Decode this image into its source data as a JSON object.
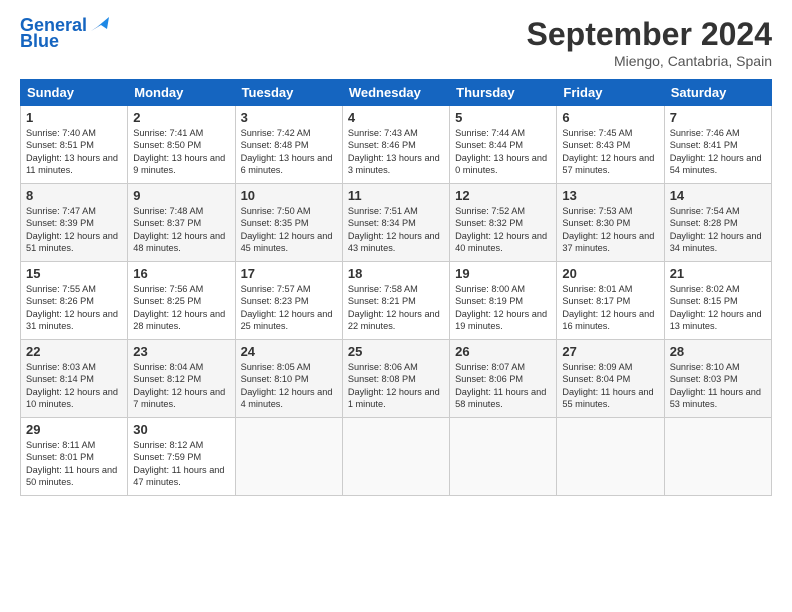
{
  "header": {
    "logo_line1": "General",
    "logo_line2": "Blue",
    "month_title": "September 2024",
    "location": "Miengo, Cantabria, Spain"
  },
  "days_of_week": [
    "Sunday",
    "Monday",
    "Tuesday",
    "Wednesday",
    "Thursday",
    "Friday",
    "Saturday"
  ],
  "weeks": [
    [
      {
        "day": "1",
        "sunrise": "7:40 AM",
        "sunset": "8:51 PM",
        "daylight": "13 hours and 11 minutes."
      },
      {
        "day": "2",
        "sunrise": "7:41 AM",
        "sunset": "8:50 PM",
        "daylight": "13 hours and 9 minutes."
      },
      {
        "day": "3",
        "sunrise": "7:42 AM",
        "sunset": "8:48 PM",
        "daylight": "13 hours and 6 minutes."
      },
      {
        "day": "4",
        "sunrise": "7:43 AM",
        "sunset": "8:46 PM",
        "daylight": "13 hours and 3 minutes."
      },
      {
        "day": "5",
        "sunrise": "7:44 AM",
        "sunset": "8:44 PM",
        "daylight": "13 hours and 0 minutes."
      },
      {
        "day": "6",
        "sunrise": "7:45 AM",
        "sunset": "8:43 PM",
        "daylight": "12 hours and 57 minutes."
      },
      {
        "day": "7",
        "sunrise": "7:46 AM",
        "sunset": "8:41 PM",
        "daylight": "12 hours and 54 minutes."
      }
    ],
    [
      {
        "day": "8",
        "sunrise": "7:47 AM",
        "sunset": "8:39 PM",
        "daylight": "12 hours and 51 minutes."
      },
      {
        "day": "9",
        "sunrise": "7:48 AM",
        "sunset": "8:37 PM",
        "daylight": "12 hours and 48 minutes."
      },
      {
        "day": "10",
        "sunrise": "7:50 AM",
        "sunset": "8:35 PM",
        "daylight": "12 hours and 45 minutes."
      },
      {
        "day": "11",
        "sunrise": "7:51 AM",
        "sunset": "8:34 PM",
        "daylight": "12 hours and 43 minutes."
      },
      {
        "day": "12",
        "sunrise": "7:52 AM",
        "sunset": "8:32 PM",
        "daylight": "12 hours and 40 minutes."
      },
      {
        "day": "13",
        "sunrise": "7:53 AM",
        "sunset": "8:30 PM",
        "daylight": "12 hours and 37 minutes."
      },
      {
        "day": "14",
        "sunrise": "7:54 AM",
        "sunset": "8:28 PM",
        "daylight": "12 hours and 34 minutes."
      }
    ],
    [
      {
        "day": "15",
        "sunrise": "7:55 AM",
        "sunset": "8:26 PM",
        "daylight": "12 hours and 31 minutes."
      },
      {
        "day": "16",
        "sunrise": "7:56 AM",
        "sunset": "8:25 PM",
        "daylight": "12 hours and 28 minutes."
      },
      {
        "day": "17",
        "sunrise": "7:57 AM",
        "sunset": "8:23 PM",
        "daylight": "12 hours and 25 minutes."
      },
      {
        "day": "18",
        "sunrise": "7:58 AM",
        "sunset": "8:21 PM",
        "daylight": "12 hours and 22 minutes."
      },
      {
        "day": "19",
        "sunrise": "8:00 AM",
        "sunset": "8:19 PM",
        "daylight": "12 hours and 19 minutes."
      },
      {
        "day": "20",
        "sunrise": "8:01 AM",
        "sunset": "8:17 PM",
        "daylight": "12 hours and 16 minutes."
      },
      {
        "day": "21",
        "sunrise": "8:02 AM",
        "sunset": "8:15 PM",
        "daylight": "12 hours and 13 minutes."
      }
    ],
    [
      {
        "day": "22",
        "sunrise": "8:03 AM",
        "sunset": "8:14 PM",
        "daylight": "12 hours and 10 minutes."
      },
      {
        "day": "23",
        "sunrise": "8:04 AM",
        "sunset": "8:12 PM",
        "daylight": "12 hours and 7 minutes."
      },
      {
        "day": "24",
        "sunrise": "8:05 AM",
        "sunset": "8:10 PM",
        "daylight": "12 hours and 4 minutes."
      },
      {
        "day": "25",
        "sunrise": "8:06 AM",
        "sunset": "8:08 PM",
        "daylight": "12 hours and 1 minute."
      },
      {
        "day": "26",
        "sunrise": "8:07 AM",
        "sunset": "8:06 PM",
        "daylight": "11 hours and 58 minutes."
      },
      {
        "day": "27",
        "sunrise": "8:09 AM",
        "sunset": "8:04 PM",
        "daylight": "11 hours and 55 minutes."
      },
      {
        "day": "28",
        "sunrise": "8:10 AM",
        "sunset": "8:03 PM",
        "daylight": "11 hours and 53 minutes."
      }
    ],
    [
      {
        "day": "29",
        "sunrise": "8:11 AM",
        "sunset": "8:01 PM",
        "daylight": "11 hours and 50 minutes."
      },
      {
        "day": "30",
        "sunrise": "8:12 AM",
        "sunset": "7:59 PM",
        "daylight": "11 hours and 47 minutes."
      },
      null,
      null,
      null,
      null,
      null
    ]
  ]
}
